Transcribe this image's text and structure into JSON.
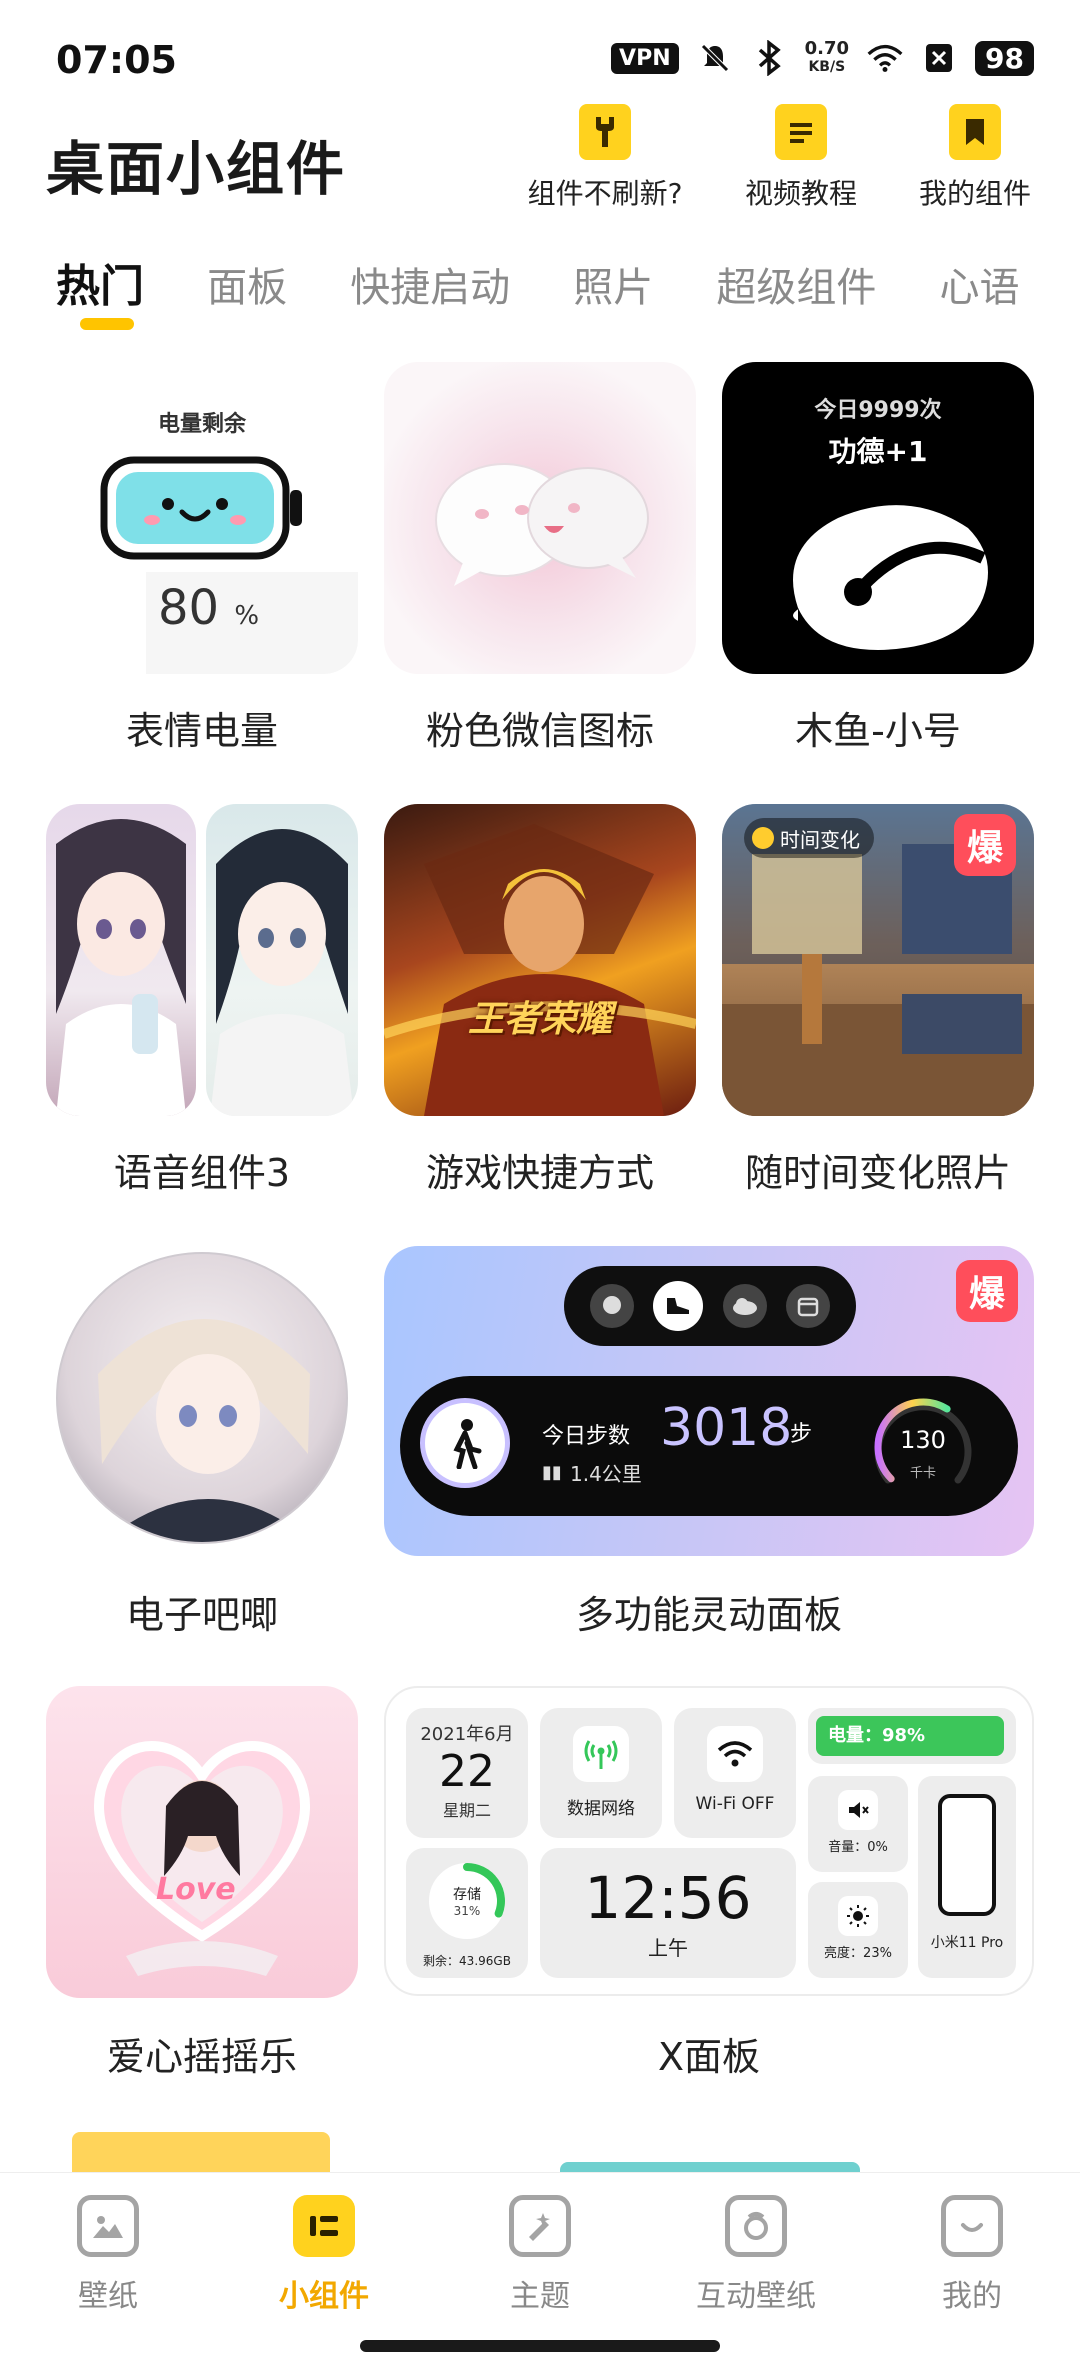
{
  "status_bar": {
    "time": "07:05",
    "vpn": "VPN",
    "speed_value": "0.70",
    "speed_unit": "KB/S",
    "battery": "98",
    "icons": [
      "mute-bell-icon",
      "bluetooth-icon",
      "wifi-icon",
      "close-box-icon"
    ]
  },
  "header": {
    "title": "桌面小组件",
    "actions": [
      {
        "label": "组件不刷新?",
        "icon": "wrench-icon"
      },
      {
        "label": "视频教程",
        "icon": "document-icon"
      },
      {
        "label": "我的组件",
        "icon": "bookmark-icon"
      }
    ]
  },
  "tabs": [
    "热门",
    "面板",
    "快捷启动",
    "照片",
    "超级组件",
    "心语"
  ],
  "active_tab": "热门",
  "cards": {
    "battery_emoji": {
      "label": "表情电量",
      "header": "电量剩余",
      "value": "80",
      "unit": "%"
    },
    "pink_wechat": {
      "label": "粉色微信图标"
    },
    "wooden_fish": {
      "label": "木鱼-小号",
      "count_text": "今日9999次",
      "merit_text": "功德+1"
    },
    "voice_widget": {
      "label": "语音组件3"
    },
    "game_shortcut": {
      "label": "游戏快捷方式",
      "game_title": "王者荣耀"
    },
    "time_photo": {
      "label": "随时间变化照片",
      "tag": "时间变化",
      "badge": "爆"
    },
    "avatar": {
      "label": "电子吧唧"
    },
    "dynamic_panel": {
      "label": "多功能灵动面板",
      "badge": "爆",
      "steps_label": "今日步数",
      "steps_value": "3018",
      "steps_unit": "步",
      "distance": "1.4公里",
      "calories_value": "130",
      "calories_unit": "千卡",
      "calories_ring": 0.62
    },
    "heart_swing": {
      "label": "爱心摇摇乐",
      "love_text": "Love"
    },
    "x_panel": {
      "label": "X面板",
      "date_month": "2021年6月",
      "date_day": "22",
      "date_weekday": "星期二",
      "network_label": "数据网络",
      "wifi_label": "Wi-Fi OFF",
      "battery_text": "电量：98%",
      "battery_level": 0.98,
      "volume_text": "音量：0%",
      "brightness_text": "亮度：23%",
      "phone_label": "小米11 Pro",
      "storage_title": "存储",
      "storage_percent": "31%",
      "storage_ring": 0.31,
      "storage_free": "剩余：43.96GB",
      "clock_time": "12:56",
      "clock_period": "上午"
    }
  },
  "bottom_nav": [
    {
      "label": "壁纸",
      "icon": "image-icon",
      "active": false
    },
    {
      "label": "小组件",
      "icon": "widget-icon",
      "active": true
    },
    {
      "label": "主题",
      "icon": "theme-icon",
      "active": false
    },
    {
      "label": "互动壁纸",
      "icon": "interactive-wallpaper-icon",
      "active": false
    },
    {
      "label": "我的",
      "icon": "profile-icon",
      "active": false
    }
  ],
  "colors": {
    "accent": "#ffd21e",
    "accent_text": "#f2a800",
    "badge_red": "#ff4e5b",
    "battery_green": "#3cc65a"
  }
}
